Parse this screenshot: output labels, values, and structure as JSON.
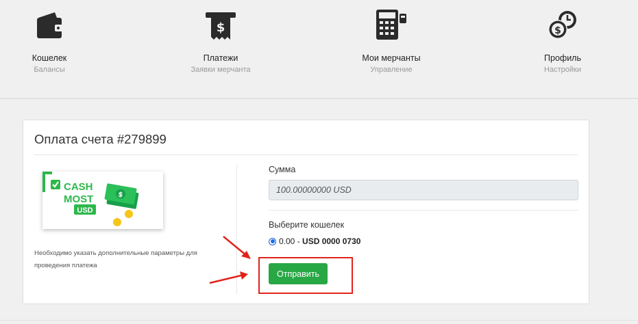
{
  "nav": {
    "items": [
      {
        "title": "Кошелек",
        "subtitle": "Балансы",
        "icon": "wallet-icon"
      },
      {
        "title": "Платежи",
        "subtitle": "Заявки мерчанта",
        "icon": "receipt-icon"
      },
      {
        "title": "Мои мерчанты",
        "subtitle": "Управление",
        "icon": "calculator-icon"
      },
      {
        "title": "Профиль",
        "subtitle": "Настройки",
        "icon": "coins-icon"
      }
    ]
  },
  "payment": {
    "title": "Оплата счета #279899",
    "note": "Необходимо указать дополнительные параметры для проведения платежа",
    "amount_label": "Сумма",
    "amount_value": "100.00000000 USD",
    "wallet_label": "Выберите кошелек",
    "wallet_balance": "0.00 -",
    "wallet_name": "USD 0000 0730",
    "submit_label": "Отправить"
  },
  "logo": {
    "line1": "CASH",
    "line2": "MOST",
    "badge": "USD"
  },
  "colors": {
    "accent_green": "#28a745",
    "highlight_red": "#e0231a",
    "icon_dark": "#2b2b2b"
  }
}
